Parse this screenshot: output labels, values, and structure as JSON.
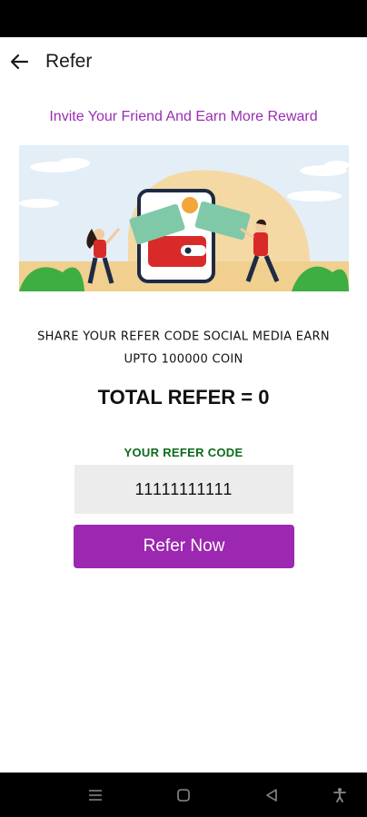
{
  "appbar": {
    "title": "Refer"
  },
  "invite_text": "Invite Your Friend And Earn More Reward",
  "share_text": "SHARE YOUR REFER CODE SOCIAL MEDIA EARN UPTO 100000 COIN",
  "total_refer": "TOTAL REFER = 0",
  "code_label": "YOUR REFER CODE",
  "refer_code": "11111111111",
  "refer_button": "Refer Now",
  "colors": {
    "accent": "#9c27b0",
    "invite_text": "#9a2db4",
    "code_label": "#0b6b1b",
    "code_box": "#ececec"
  },
  "icons": [
    "back-arrow-icon",
    "menu-icon",
    "home-icon",
    "back-icon",
    "accessibility-icon"
  ]
}
